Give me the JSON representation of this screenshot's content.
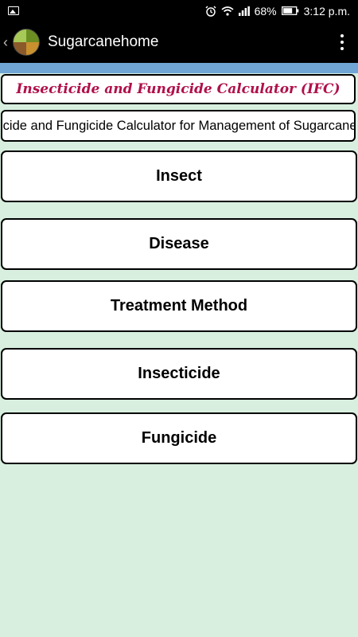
{
  "status_bar": {
    "battery": "68%",
    "time": "3:12 p.m."
  },
  "app_bar": {
    "title": "Sugarcanehome"
  },
  "header": {
    "title": "Insecticide and Fungicide Calculator (IFC)",
    "marquee": "Insecticide and Fungicide Calculator for Management of Sugarcane"
  },
  "menu": {
    "items": [
      {
        "label": "Insect"
      },
      {
        "label": "Disease"
      },
      {
        "label": "Treatment Method"
      },
      {
        "label": "Insecticide"
      },
      {
        "label": "Fungicide"
      }
    ]
  },
  "colors": {
    "background": "#d8efdf",
    "title_text": "#b0104a",
    "accent_strip": "#6fa6d6"
  }
}
